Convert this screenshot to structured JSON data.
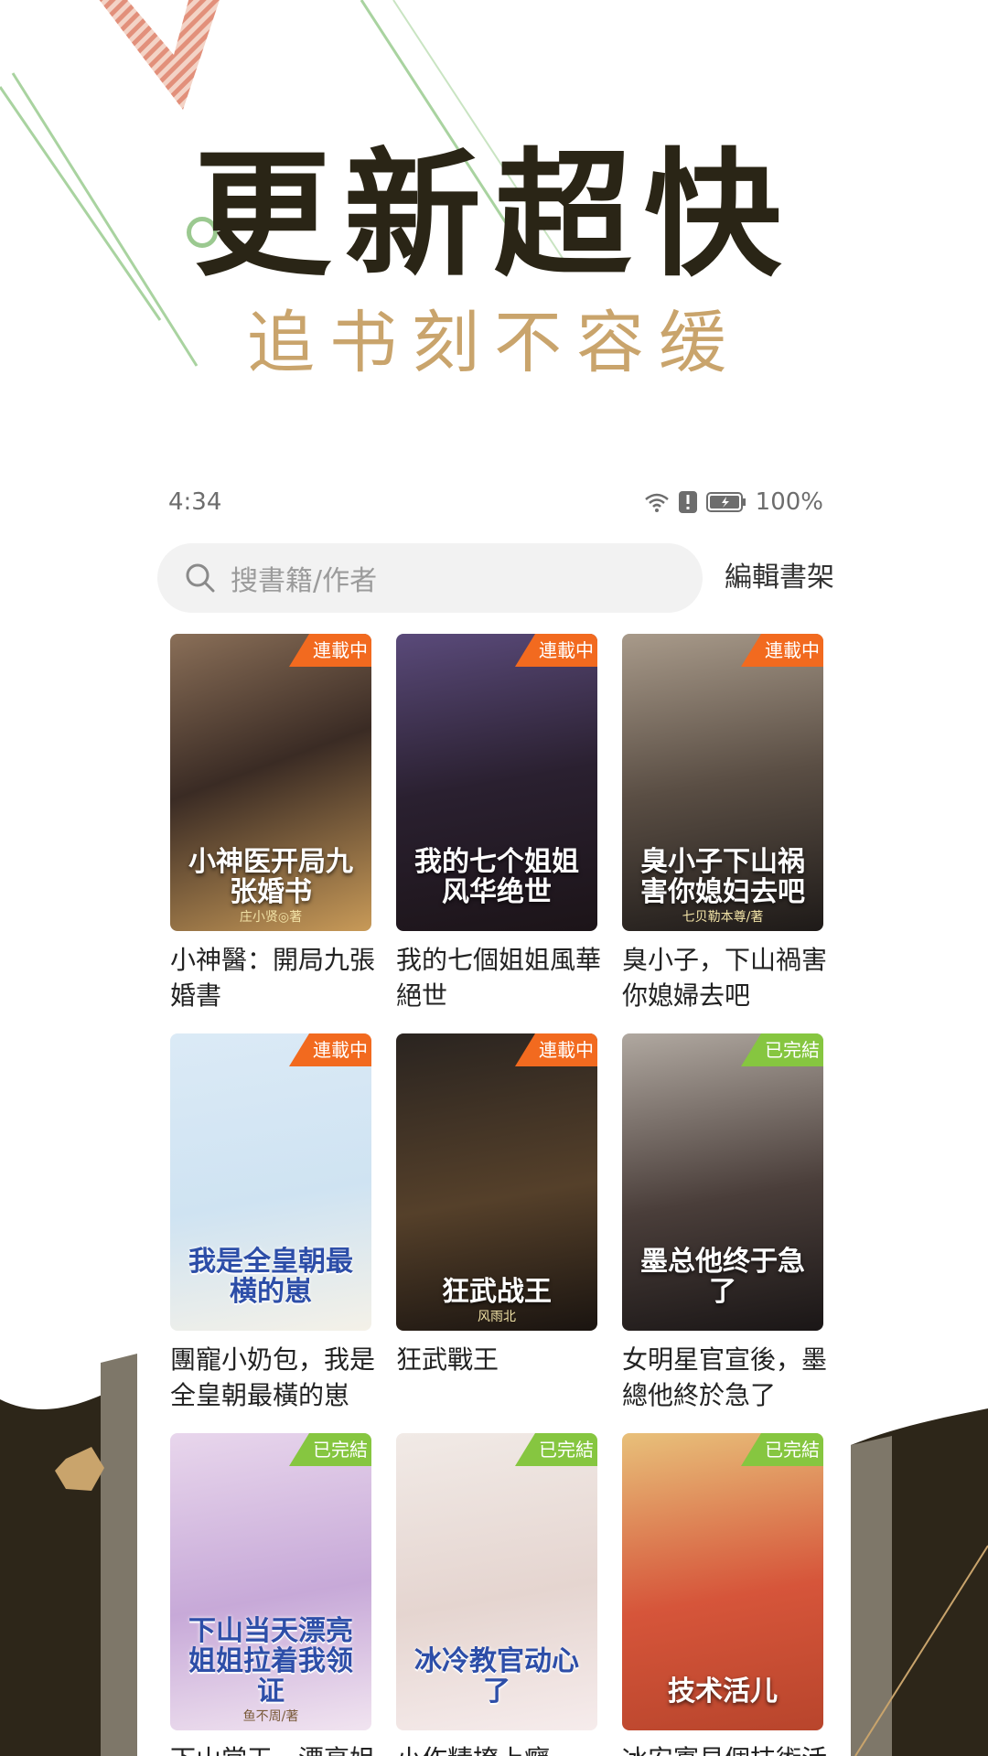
{
  "hero": {
    "title": "更新超快",
    "subtitle": "追书刻不容缓"
  },
  "colors": {
    "title": "#2a2516",
    "subtitle": "#c9a46c",
    "ongoing": "#f26a1f",
    "finished": "#86c640"
  },
  "status_bar": {
    "time": "4:34",
    "battery": "100%",
    "icons": [
      "wifi-icon",
      "alert-icon",
      "battery-icon"
    ]
  },
  "search": {
    "placeholder": "搜書籍/作者",
    "icon": "search-icon"
  },
  "edit_shelf_label": "編輯書架",
  "books": [
    {
      "title": "小神醫：開局九張婚書",
      "status": "連載中",
      "status_type": "ongoing",
      "cover_text": "小神医开局九张婚书",
      "cover_author": "庄小贤◎著"
    },
    {
      "title": "我的七個姐姐風華絕世",
      "status": "連載中",
      "status_type": "ongoing",
      "cover_text": "我的七个姐姐风华绝世",
      "cover_author": ""
    },
    {
      "title": "臭小子，下山禍害你媳婦去吧",
      "status": "連載中",
      "status_type": "ongoing",
      "cover_text": "臭小子下山祸害你媳妇去吧",
      "cover_author": "七贝勒本尊/著"
    },
    {
      "title": "團寵小奶包，我是全皇朝最橫的崽",
      "status": "連載中",
      "status_type": "ongoing",
      "cover_text": "我是全皇朝最横的崽",
      "cover_author": ""
    },
    {
      "title": "狂武戰王",
      "status": "連載中",
      "status_type": "ongoing",
      "cover_text": "狂武战王",
      "cover_author": "风雨北"
    },
    {
      "title": "女明星官宣後，墨總他終於急了",
      "status": "已完結",
      "status_type": "finished",
      "cover_text": "墨总他终于急了",
      "cover_author": ""
    },
    {
      "title": "下山當天，漂亮姐",
      "status": "已完結",
      "status_type": "finished",
      "cover_text": "下山当天漂亮姐姐拉着我领证",
      "cover_author": "鱼不周/著"
    },
    {
      "title": "小作精撩上癮，",
      "status": "已完結",
      "status_type": "finished",
      "cover_text": "冰冷教官动心了",
      "cover_author": ""
    },
    {
      "title": "冰安寡見個技術活兒",
      "status": "已完結",
      "status_type": "finished",
      "cover_text": "技术活儿",
      "cover_author": ""
    }
  ]
}
